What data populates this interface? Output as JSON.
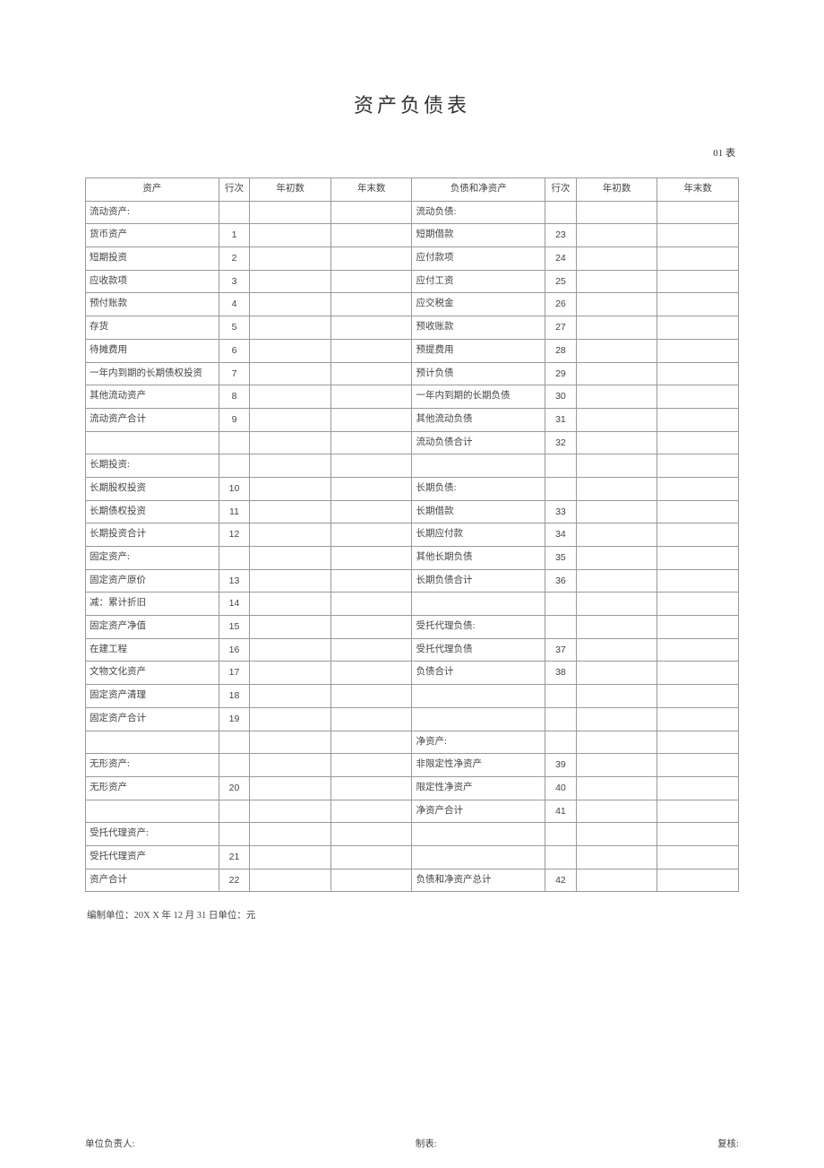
{
  "title": "资产负债表",
  "top_right": "01 表",
  "headers": {
    "asset": "资产",
    "line": "行次",
    "begin": "年初数",
    "end": "年末数",
    "liab": "负债和净资产"
  },
  "below_note": "编制单位：20X X 年 12 月 31 日单位：元",
  "footer": {
    "left": "单位负责人:",
    "mid": "制表:",
    "right": "复核:"
  },
  "rows": [
    {
      "a": "流动资产:",
      "ai": 0,
      "al": "",
      "l": "流动负债:",
      "li": 0,
      "ll": ""
    },
    {
      "a": "货币资产",
      "ai": 1,
      "al": "1",
      "l": "短期借款",
      "li": 2,
      "ll": "23"
    },
    {
      "a": "短期投资",
      "ai": 1,
      "al": "2",
      "l": "应付款项",
      "li": 2,
      "ll": "24"
    },
    {
      "a": "应收款项",
      "ai": 1,
      "al": "3",
      "l": "应付工资",
      "li": 2,
      "ll": "25"
    },
    {
      "a": "预付账款",
      "ai": 1,
      "al": "4",
      "l": "应交税金",
      "li": 2,
      "ll": "26"
    },
    {
      "a": "存货",
      "ai": 1,
      "al": "5",
      "l": "预收账款",
      "li": 2,
      "ll": "27"
    },
    {
      "a": "待摊费用",
      "ai": 1,
      "al": "6",
      "l": "预提费用",
      "li": 2,
      "ll": "28"
    },
    {
      "a": "一年内到期的长期债权投资",
      "ai": 1,
      "al": "7",
      "l": "预计负债",
      "li": 2,
      "ll": "29"
    },
    {
      "a": "其他流动资产",
      "ai": 1,
      "al": "8",
      "l": "一年内到期的长期负债",
      "li": 2,
      "ll": "30"
    },
    {
      "a": "流动资产合计",
      "ai": 2,
      "al": "9",
      "l": "其他流动负债",
      "li": 2,
      "ll": "31"
    },
    {
      "a": "",
      "ai": 0,
      "al": "",
      "l": "流动负债合计",
      "li": 3,
      "ll": "32"
    },
    {
      "a": "长期投资:",
      "ai": 0,
      "al": "",
      "l": "",
      "li": 0,
      "ll": ""
    },
    {
      "a": "长期股权投资",
      "ai": 1,
      "al": "10",
      "l": "长期负债:",
      "li": 1,
      "ll": ""
    },
    {
      "a": "长期债权投资",
      "ai": 1,
      "al": "11",
      "l": "长期借款",
      "li": 2,
      "ll": "33"
    },
    {
      "a": "长期投资合计",
      "ai": 0,
      "al": "12",
      "l": "长期应付款",
      "li": 2,
      "ll": "34"
    },
    {
      "a": "固定资产:",
      "ai": 0,
      "al": "",
      "l": "其他长期负债",
      "li": 2,
      "ll": "35"
    },
    {
      "a": "固定资产原价",
      "ai": 1,
      "al": "13",
      "l": "长期负债合计",
      "li": 2,
      "ll": "36"
    },
    {
      "a": "减：累计折旧",
      "ai": 1,
      "al": "14",
      "l": "",
      "li": 0,
      "ll": ""
    },
    {
      "a": "固定资产净值",
      "ai": 1,
      "al": "15",
      "l": "受托代理负债:",
      "li": 1,
      "ll": ""
    },
    {
      "a": "在建工程",
      "ai": 1,
      "al": "16",
      "l": "受托代理负债",
      "li": 2,
      "ll": "37"
    },
    {
      "a": "文物文化资产",
      "ai": 1,
      "al": "17",
      "l": "负债合计",
      "li": 3,
      "ll": "38"
    },
    {
      "a": "固定资产清理",
      "ai": 1,
      "al": "18",
      "l": "",
      "li": 0,
      "ll": ""
    },
    {
      "a": "固定资产合计",
      "ai": 2,
      "al": "19",
      "l": "",
      "li": 0,
      "ll": ""
    },
    {
      "a": "",
      "ai": 0,
      "al": "",
      "l": "净资产:",
      "li": 1,
      "ll": ""
    },
    {
      "a": "无形资产:",
      "ai": 0,
      "al": "",
      "l": "非限定性净资产",
      "li": 2,
      "ll": "39"
    },
    {
      "a": "无形资产",
      "ai": 1,
      "al": "20",
      "l": "限定性净资产",
      "li": 2,
      "ll": "40"
    },
    {
      "a": "",
      "ai": 0,
      "al": "",
      "l": "净资产合计",
      "li": 3,
      "ll": "41"
    },
    {
      "a": "受托代理资产:",
      "ai": 0,
      "al": "",
      "l": "",
      "li": 0,
      "ll": ""
    },
    {
      "a": "受托代理资产",
      "ai": 1,
      "al": "21",
      "l": "",
      "li": 0,
      "ll": ""
    },
    {
      "a": "资产合计",
      "ai": 3,
      "al": "22",
      "l": "负债和净资产总计",
      "li": 2,
      "ll": "42"
    }
  ]
}
